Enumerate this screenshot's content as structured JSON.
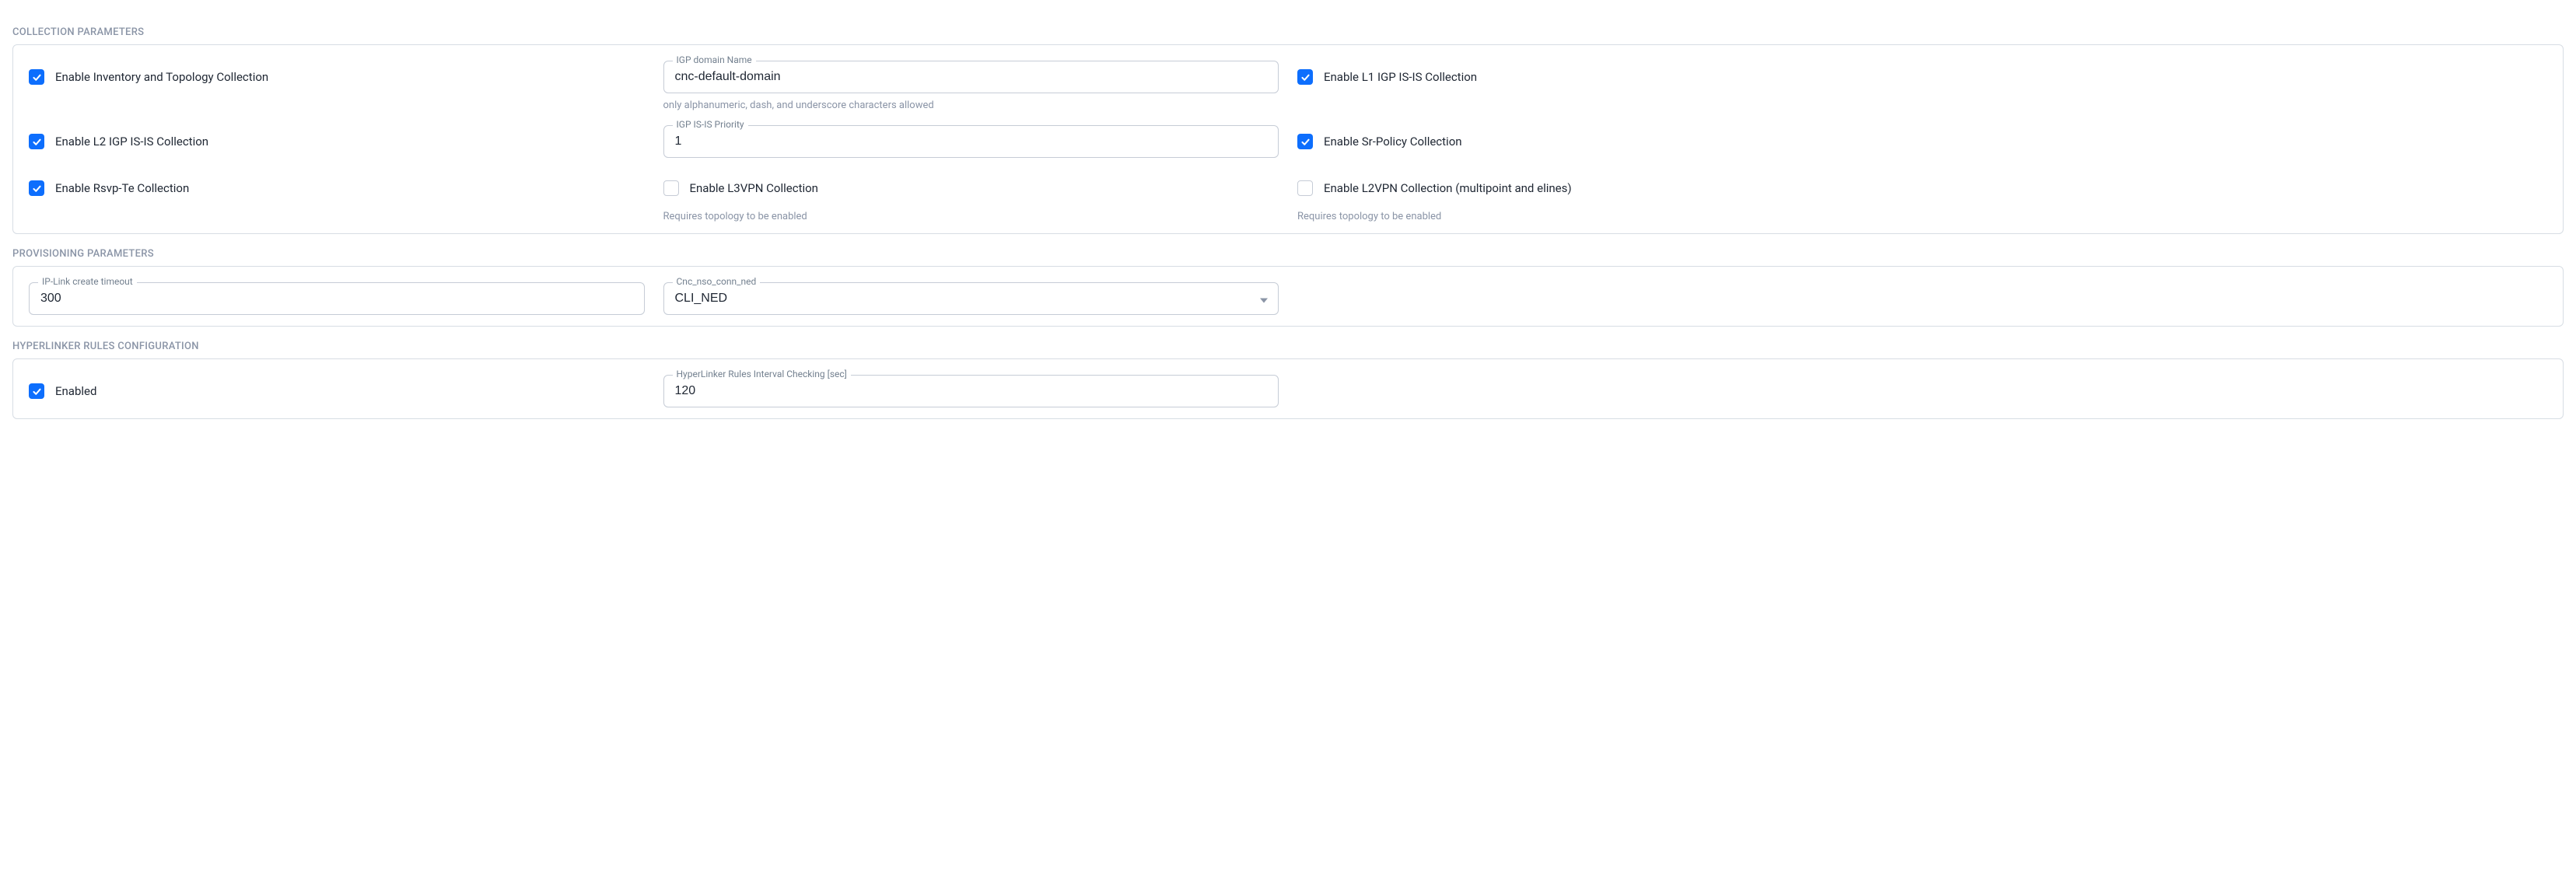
{
  "collection": {
    "title": "COLLECTION PARAMETERS",
    "enable_inventory": {
      "label": "Enable Inventory and Topology Collection",
      "checked": true
    },
    "igp_domain": {
      "label": "IGP domain Name",
      "value": "cnc-default-domain",
      "hint": "only alphanumeric, dash, and underscore characters allowed"
    },
    "enable_l1": {
      "label": "Enable L1 IGP IS-IS Collection",
      "checked": true
    },
    "enable_l2": {
      "label": "Enable L2 IGP IS-IS Collection",
      "checked": true
    },
    "isis_priority": {
      "label": "IGP IS-IS Priority",
      "value": "1"
    },
    "enable_sr": {
      "label": "Enable Sr-Policy Collection",
      "checked": true
    },
    "enable_rsvp": {
      "label": "Enable Rsvp-Te Collection",
      "checked": true
    },
    "enable_l3vpn": {
      "label": "Enable L3VPN Collection",
      "checked": false,
      "hint": "Requires topology to be enabled"
    },
    "enable_l2vpn": {
      "label": "Enable L2VPN Collection (multipoint and elines)",
      "checked": false,
      "hint": "Requires topology to be enabled"
    }
  },
  "provisioning": {
    "title": "PROVISIONING PARAMETERS",
    "ip_link_timeout": {
      "label": "IP-Link create timeout",
      "value": "300"
    },
    "cnc_nso": {
      "label": "Cnc_nso_conn_ned",
      "value": "CLI_NED"
    }
  },
  "hyperlinker": {
    "title": "HYPERLINKER RULES CONFIGURATION",
    "enabled": {
      "label": "Enabled",
      "checked": true
    },
    "interval": {
      "label": "HyperLinker Rules Interval Checking [sec]",
      "value": "120"
    }
  }
}
